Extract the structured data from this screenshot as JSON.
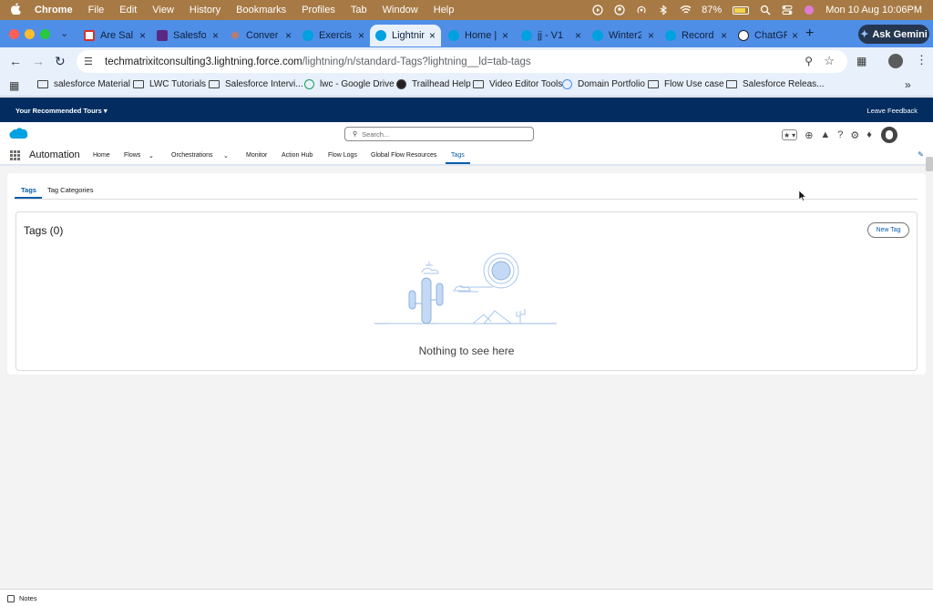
{
  "menubar": {
    "app": "Chrome",
    "menus": [
      "File",
      "Edit",
      "View",
      "History",
      "Bookmarks",
      "Profiles",
      "Tab",
      "Window",
      "Help"
    ],
    "battery": "87%",
    "clock": "Mon 10 Aug  10:06PM"
  },
  "tabs": [
    {
      "title": "Are Sale",
      "favicon": "gmail-icon",
      "color": "#d93025"
    },
    {
      "title": "Salesfo",
      "favicon": "salesforce-purple-icon",
      "color": "#5a2a82"
    },
    {
      "title": "Conver",
      "favicon": "asterisk-icon",
      "color": "#e8743b"
    },
    {
      "title": "Exercis",
      "favicon": "salesforce-icon",
      "color": "#00a1e0"
    },
    {
      "title": "Lightnin",
      "favicon": "salesforce-icon",
      "color": "#00a1e0",
      "active": true
    },
    {
      "title": "Home |",
      "favicon": "salesforce-icon",
      "color": "#00a1e0"
    },
    {
      "title": "jj - V1",
      "favicon": "salesforce-icon",
      "color": "#00a1e0"
    },
    {
      "title": "Winter2",
      "favicon": "salesforce-icon",
      "color": "#00a1e0"
    },
    {
      "title": "Record",
      "favicon": "salesforce-icon",
      "color": "#00a1e0"
    },
    {
      "title": "ChatGP",
      "favicon": "chatgpt-icon",
      "color": "#ffffff"
    }
  ],
  "gemini_label": "Ask Gemini",
  "address": {
    "host": "techmatrixitconsulting3.lightning.force.com",
    "path": "/lightning/n/standard-Tags?lightning__ld=tab-tags"
  },
  "bookmarks": [
    "salesforce Material",
    "LWC Tutorials",
    "Salesforce Intervi...",
    "lwc - Google Drive",
    "Trailhead Help",
    "Video Editor Tools",
    "Domain Portfolio",
    "Flow Use case",
    "Salesforce Releas..."
  ],
  "tours": {
    "left": "Your Recommended Tours",
    "right": "Leave Feedback"
  },
  "search_placeholder": "Search...",
  "app_name": "Automation",
  "nav": [
    "Home",
    "Flows",
    "Orchestrations",
    "Monitor",
    "Action Hub",
    "Flow Logs",
    "Global Flow Resources",
    "Tags"
  ],
  "subtabs": [
    "Tags",
    "Tag Categories"
  ],
  "list": {
    "title": "Tags (0)",
    "new_button": "New Tag",
    "empty_text": "Nothing to see here"
  },
  "footer": {
    "notes": "Notes"
  },
  "colors": {
    "menubar": "#a77a45",
    "tabstrip": "#4f8ee6",
    "tours_bar": "#032d60",
    "brand_blue": "#0b5cab"
  }
}
